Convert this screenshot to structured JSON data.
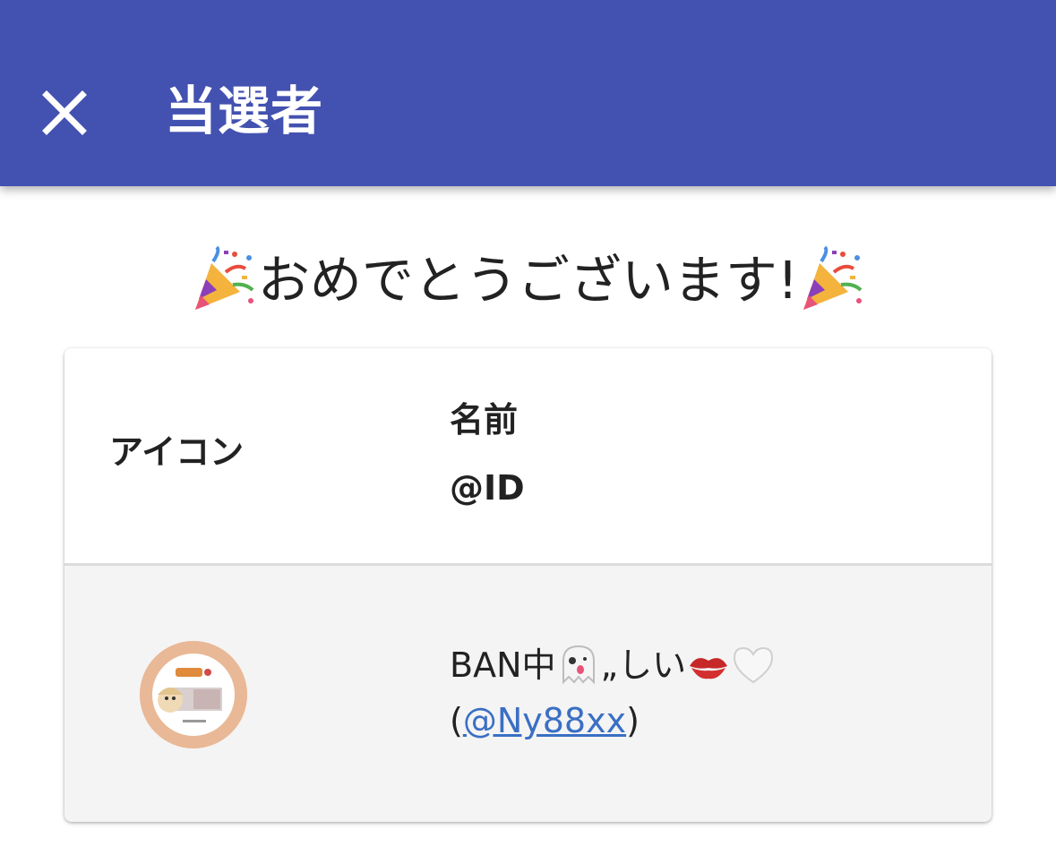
{
  "appbar": {
    "title": "当選者",
    "close_icon": "close-icon",
    "background_color": "#4352b0"
  },
  "congrats": {
    "text": "おめでとうございます!",
    "emoji_icon": "party-popper-icon"
  },
  "table": {
    "headers": {
      "icon": "アイコン",
      "name": "名前",
      "id": "@ID"
    },
    "rows": [
      {
        "avatar_icon": "user-avatar",
        "name": "BAN中",
        "name_suffix": "„しい",
        "name_emojis": [
          "ghost-icon",
          "kiss-mark-icon",
          "white-heart-icon"
        ],
        "id_open": "(",
        "id_link": "@Ny88xx",
        "id_close": ")"
      }
    ]
  },
  "colors": {
    "link": "#3a6fc4",
    "row_background": "#f4f4f4"
  }
}
